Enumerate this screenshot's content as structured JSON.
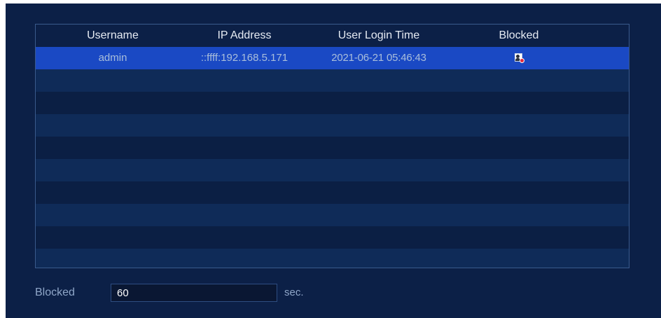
{
  "table": {
    "columns": [
      "Username",
      "IP Address",
      "User Login Time",
      "Blocked"
    ],
    "rows": [
      {
        "username": "admin",
        "ip_address": "::ffff:192.168.5.171",
        "login_time": "2021-06-21 05:46:43",
        "blocked_icon": "blocked-user-icon",
        "selected": true
      }
    ],
    "empty_row_count": 9
  },
  "footer": {
    "blocked_label": "Blocked",
    "blocked_value": "60",
    "unit_label": "sec."
  },
  "colors": {
    "background": "#0c2047",
    "selected_row": "#1a49c4",
    "header_text": "#e6ebf3",
    "cell_text": "#a9bedb"
  }
}
